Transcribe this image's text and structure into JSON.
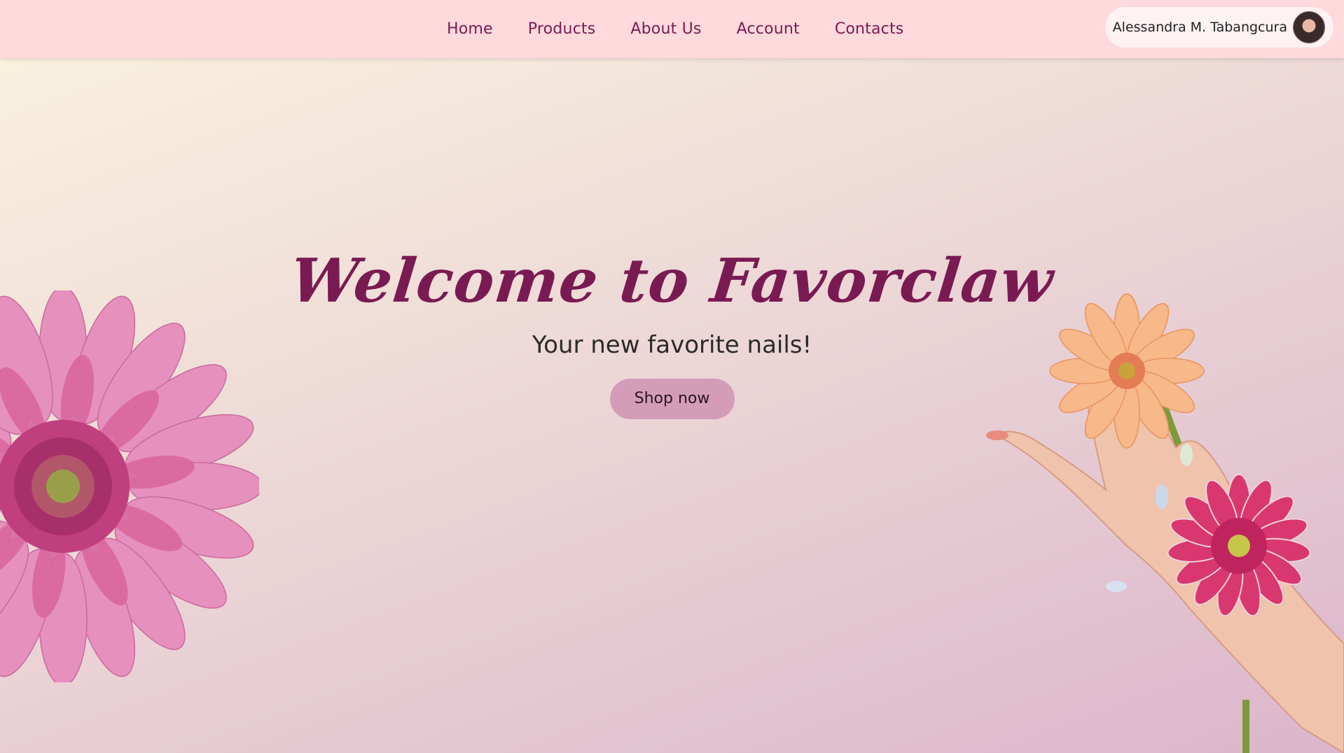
{
  "nav": {
    "links": [
      "Home",
      "Products",
      "About Us",
      "Account",
      "Contacts"
    ]
  },
  "profile": {
    "name": "Alessandra M. Tabangcura"
  },
  "hero": {
    "title": "Welcome to Favorclaw",
    "subtitle": "Your new favorite nails!",
    "cta": "Shop now"
  },
  "colors": {
    "accent": "#7a1a52",
    "navbar": "#ffd9dc",
    "button": "#d39cb7"
  },
  "icons": {
    "avatar": "user-avatar-photo",
    "left_decor": "pink-gerbera-flower",
    "right_decor": "hand-with-flowers"
  }
}
